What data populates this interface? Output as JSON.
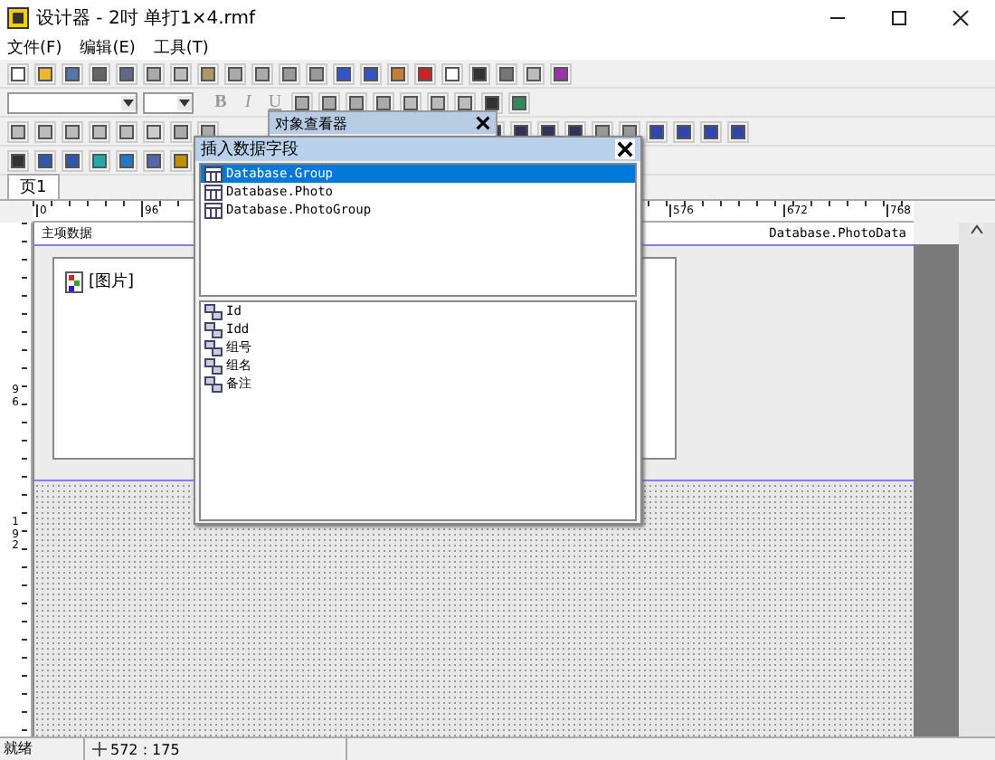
{
  "window": {
    "title": "设计器 - 2吋 单打1×4.rmf"
  },
  "menu": [
    {
      "label": "文件(F)"
    },
    {
      "label": "编辑(E)"
    },
    {
      "label": "工具(T)"
    }
  ],
  "format_toolbar": {
    "bold": "B",
    "italic": "I",
    "underline": "U"
  },
  "page_tabs": [
    {
      "label": "页1",
      "selected": true
    }
  ],
  "ruler": {
    "top_marks": [
      "0",
      "96",
      "576",
      "672",
      "768"
    ],
    "left_marks": [
      "96",
      "192"
    ]
  },
  "report": {
    "band_title": "主项数据",
    "band_source": "Database.PhotoData",
    "picture_label": "[图片]"
  },
  "object_inspector": {
    "title": "对象查看器"
  },
  "dialog": {
    "title": "插入数据字段",
    "datasets": [
      {
        "label": "Database.Group",
        "selected": true
      },
      {
        "label": "Database.Photo",
        "selected": false
      },
      {
        "label": "Database.PhotoGroup",
        "selected": false
      }
    ],
    "fields": [
      {
        "label": "Id"
      },
      {
        "label": "Idd"
      },
      {
        "label": "组号"
      },
      {
        "label": "组名"
      },
      {
        "label": "备注"
      }
    ]
  },
  "status_bar": {
    "message": "就绪",
    "position": "572 : 175"
  }
}
